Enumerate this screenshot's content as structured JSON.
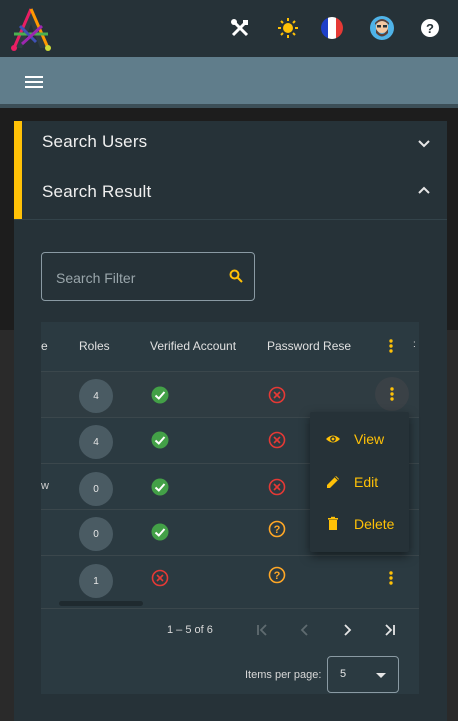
{
  "colors": {
    "accent": "#ffc107",
    "topbar": "#263238",
    "toolbar": "#607d8b",
    "panel": "#263238",
    "success": "#43a047",
    "error": "#e53935",
    "warning": "#ffa726"
  },
  "header": {
    "icons": [
      "tools-icon",
      "theme-sun-icon",
      "french-flag-icon",
      "user-avatar-icon",
      "help-icon"
    ]
  },
  "panels": {
    "search_users": "Search Users",
    "search_result": "Search Result"
  },
  "search": {
    "placeholder": "Search Filter"
  },
  "table": {
    "headers": {
      "cut": "e",
      "roles": "Roles",
      "verified": "Verified Account",
      "password": "Password Rese"
    },
    "rows": [
      {
        "cut": "",
        "roles": "4",
        "verified": "check",
        "password": "cancel"
      },
      {
        "cut": "",
        "roles": "4",
        "verified": "check",
        "password": "cancel"
      },
      {
        "cut": "w",
        "roles": "0",
        "verified": "check",
        "password": "cancel"
      },
      {
        "cut": "",
        "roles": "0",
        "verified": "check",
        "password": "help"
      },
      {
        "cut": "",
        "roles": "1",
        "verified": "cancel",
        "password": "help"
      }
    ]
  },
  "paginator": {
    "range": "1 – 5 of 6",
    "items_per_page_label": "Items per page:",
    "page_size": "5"
  },
  "row_menu": {
    "view": "View",
    "edit": "Edit",
    "delete": "Delete"
  }
}
